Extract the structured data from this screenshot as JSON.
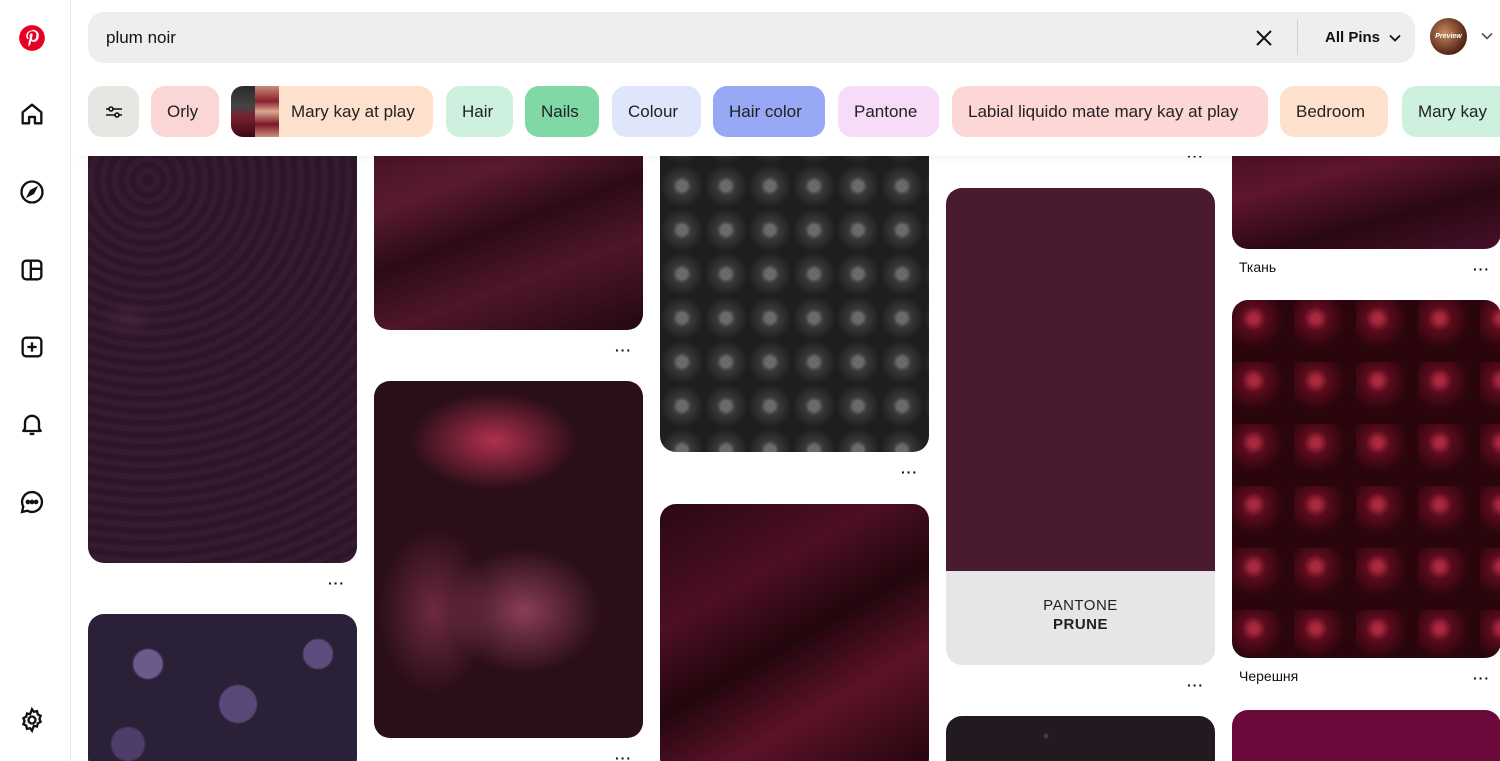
{
  "search": {
    "value": "plum noir",
    "scope_label": "All Pins"
  },
  "account": {
    "avatar_text": "Preview"
  },
  "chips": [
    {
      "label": "Orly",
      "color": "#fbd6d6"
    },
    {
      "label": "Mary kay at play",
      "color": "#fde1cc"
    },
    {
      "label": "Hair",
      "color": "#cdf0df"
    },
    {
      "label": "Nails",
      "color": "#7fd8a6"
    },
    {
      "label": "Colour",
      "color": "#dfe6fb"
    },
    {
      "label": "Hair color",
      "color": "#97a8f5"
    },
    {
      "label": "Pantone",
      "color": "#f6dcf6"
    },
    {
      "label": "Labial liquido mate mary kay at play",
      "color": "#fdd6d6"
    },
    {
      "label": "Bedroom",
      "color": "#fde1cc"
    },
    {
      "label": "Mary kay",
      "color": "#cdf0df"
    }
  ],
  "pins": {
    "pantone_card": {
      "line1": "PANTONE",
      "line2": "PRUNE"
    },
    "fabric_title": "Ткань",
    "cherries_title": "Черешня"
  },
  "more_label": "···"
}
